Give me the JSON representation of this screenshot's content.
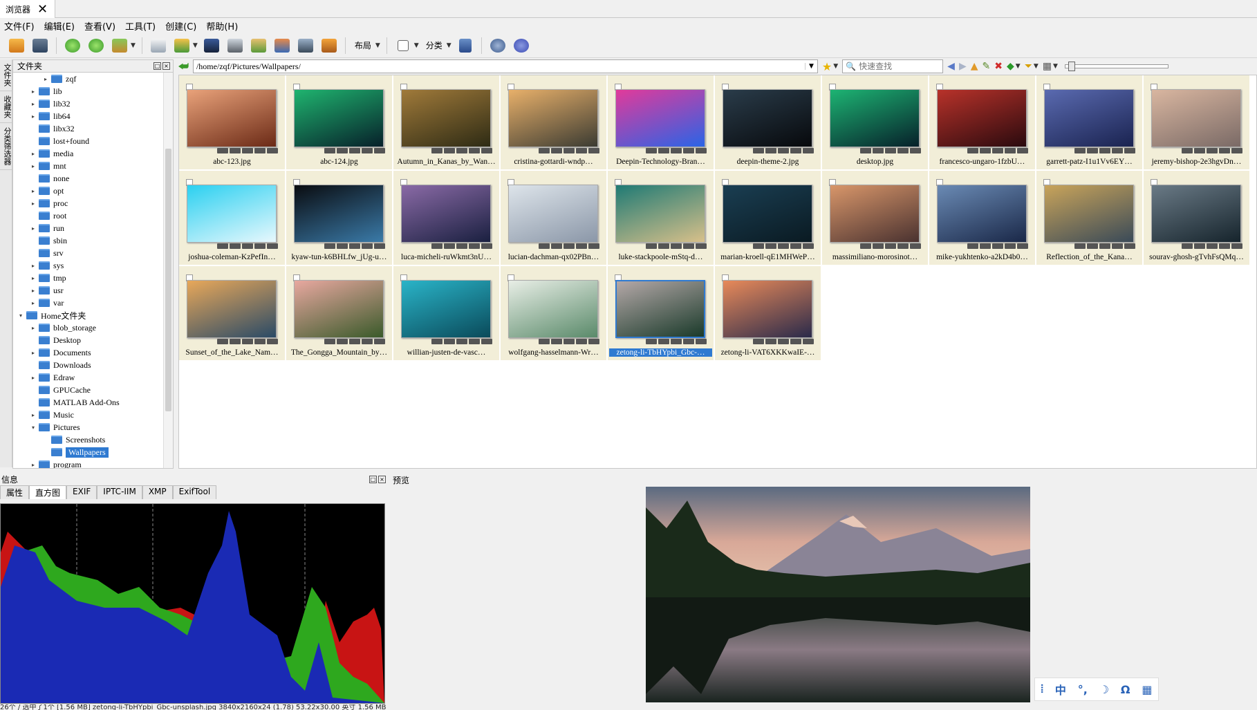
{
  "tab": {
    "title": "浏览器",
    "close": "✕"
  },
  "menu": [
    "文件(F)",
    "编辑(E)",
    "查看(V)",
    "工具(T)",
    "创建(C)",
    "帮助(H)"
  ],
  "toolbar": {
    "layout_label": "布局",
    "sort_label": "分类"
  },
  "vtabs": [
    "文件夹",
    "收藏夹",
    "分类筛选器"
  ],
  "folder_panel": {
    "title": "文件夹"
  },
  "tree": [
    {
      "label": "zqf",
      "indent": 2,
      "arrow": "▸"
    },
    {
      "label": "lib",
      "indent": 1,
      "arrow": "▸"
    },
    {
      "label": "lib32",
      "indent": 1,
      "arrow": "▸"
    },
    {
      "label": "lib64",
      "indent": 1,
      "arrow": "▸"
    },
    {
      "label": "libx32",
      "indent": 1,
      "arrow": ""
    },
    {
      "label": "lost+found",
      "indent": 1,
      "arrow": ""
    },
    {
      "label": "media",
      "indent": 1,
      "arrow": "▸"
    },
    {
      "label": "mnt",
      "indent": 1,
      "arrow": "▸"
    },
    {
      "label": "none",
      "indent": 1,
      "arrow": ""
    },
    {
      "label": "opt",
      "indent": 1,
      "arrow": "▸"
    },
    {
      "label": "proc",
      "indent": 1,
      "arrow": "▸"
    },
    {
      "label": "root",
      "indent": 1,
      "arrow": ""
    },
    {
      "label": "run",
      "indent": 1,
      "arrow": "▸"
    },
    {
      "label": "sbin",
      "indent": 1,
      "arrow": ""
    },
    {
      "label": "srv",
      "indent": 1,
      "arrow": ""
    },
    {
      "label": "sys",
      "indent": 1,
      "arrow": "▸"
    },
    {
      "label": "tmp",
      "indent": 1,
      "arrow": "▸"
    },
    {
      "label": "usr",
      "indent": 1,
      "arrow": "▸"
    },
    {
      "label": "var",
      "indent": 1,
      "arrow": "▸"
    },
    {
      "label": "Home文件夹",
      "indent": 0,
      "arrow": "▾"
    },
    {
      "label": "blob_storage",
      "indent": 1,
      "arrow": "▸"
    },
    {
      "label": "Desktop",
      "indent": 1,
      "arrow": ""
    },
    {
      "label": "Documents",
      "indent": 1,
      "arrow": "▸"
    },
    {
      "label": "Downloads",
      "indent": 1,
      "arrow": ""
    },
    {
      "label": "Edraw",
      "indent": 1,
      "arrow": "▸"
    },
    {
      "label": "GPUCache",
      "indent": 1,
      "arrow": ""
    },
    {
      "label": "MATLAB Add-Ons",
      "indent": 1,
      "arrow": ""
    },
    {
      "label": "Music",
      "indent": 1,
      "arrow": "▸"
    },
    {
      "label": "Pictures",
      "indent": 1,
      "arrow": "▾"
    },
    {
      "label": "Screenshots",
      "indent": 2,
      "arrow": ""
    },
    {
      "label": "Wallpapers",
      "indent": 2,
      "arrow": "",
      "selected": true
    },
    {
      "label": "program",
      "indent": 1,
      "arrow": "▸"
    }
  ],
  "address": {
    "path": "/home/zqf/Pictures/Wallpapers/"
  },
  "search": {
    "placeholder": "快速查找"
  },
  "files": [
    {
      "name": "abc-123.jpg",
      "c1": "#e9a27a",
      "c2": "#6b2a16"
    },
    {
      "name": "abc-124.jpg",
      "c1": "#1fb46f",
      "c2": "#07202a"
    },
    {
      "name": "Autumn_in_Kanas_by_Wan…",
      "c1": "#a07a3a",
      "c2": "#2e2b14"
    },
    {
      "name": "cristina-gottardi-wndp…",
      "c1": "#e8b06a",
      "c2": "#3b3b32"
    },
    {
      "name": "Deepin-Technology-Bran…",
      "c1": "#e23a9a",
      "c2": "#2a64e6"
    },
    {
      "name": "deepin-theme-2.jpg",
      "c1": "#2a3c4a",
      "c2": "#07090c"
    },
    {
      "name": "desktop.jpg",
      "c1": "#1db473",
      "c2": "#07202a"
    },
    {
      "name": "francesco-ungaro-1fzbU…",
      "c1": "#b8322a",
      "c2": "#2a0a0e"
    },
    {
      "name": "garrett-patz-I1u1Vv6EY…",
      "c1": "#5a6ab0",
      "c2": "#1a2350"
    },
    {
      "name": "jeremy-bishop-2e3hgvDn…",
      "c1": "#d9b6a0",
      "c2": "#7a6a66"
    },
    {
      "name": "joshua-coleman-KzPefIn…",
      "c1": "#2bd0f0",
      "c2": "#e8f8fd"
    },
    {
      "name": "kyaw-tun-k6BHLfw_jUg-u…",
      "c1": "#0a0c10",
      "c2": "#3a7aa8"
    },
    {
      "name": "luca-micheli-ruWkmt3nU…",
      "c1": "#8a6aa6",
      "c2": "#1a2040"
    },
    {
      "name": "lucian-dachman-qx02PBn…",
      "c1": "#dde4ea",
      "c2": "#8b97a8"
    },
    {
      "name": "luke-stackpoole-mStq-d…",
      "c1": "#1f7a74",
      "c2": "#d8c08a"
    },
    {
      "name": "marian-kroell-qE1MHWeP…",
      "c1": "#1a3e52",
      "c2": "#0a1a22"
    },
    {
      "name": "massimiliano-morosinot…",
      "c1": "#d8966a",
      "c2": "#4a3230"
    },
    {
      "name": "mike-yukhtenko-a2kD4b0…",
      "c1": "#6a8ab4",
      "c2": "#1a2848"
    },
    {
      "name": "Reflection_of_the_Kana…",
      "c1": "#c9a45a",
      "c2": "#3a4a58"
    },
    {
      "name": "sourav-ghosh-gTvhFsQMq…",
      "c1": "#6a7a86",
      "c2": "#16242c"
    },
    {
      "name": "Sunset_of_the_Lake_Nam…",
      "c1": "#e8a85a",
      "c2": "#2a4a66"
    },
    {
      "name": "The_Gongga_Mountain_by…",
      "c1": "#e8a8a0",
      "c2": "#3a5a2a"
    },
    {
      "name": "willian-justen-de-vasc…",
      "c1": "#2ab4c8",
      "c2": "#0a4a5a"
    },
    {
      "name": "wolfgang-hasselmann-Wr…",
      "c1": "#e8eee6",
      "c2": "#5a8a6a"
    },
    {
      "name": "zetong-li-TbHYpbi_Gbc-…",
      "c1": "#b4a8a8",
      "c2": "#1a3a2a",
      "selected": true
    },
    {
      "name": "zetong-li-VAT6XKKwaIE-…",
      "c1": "#e88a5a",
      "c2": "#2a2a4a"
    }
  ],
  "info": {
    "title": "信息",
    "tabs": [
      "属性",
      "直方图",
      "EXIF",
      "IPTC-IIM",
      "XMP",
      "ExifTool"
    ],
    "active_tab": 1
  },
  "preview": {
    "title": "预览"
  },
  "ime": [
    "中",
    "°,",
    "☽",
    "Ω",
    "▦"
  ],
  "status": {
    "text": "26个 / 选中了1个 [1.56 MB] zetong-li-TbHYpbi_Gbc-unsplash.jpg 3840x2160x24 (1.78) 53.22x30.00 英寸 1.56 MB"
  },
  "colors": {
    "accent": "#2f7ad1",
    "folder": "#3a7fd0",
    "cell_bg": "#f2eed8"
  }
}
